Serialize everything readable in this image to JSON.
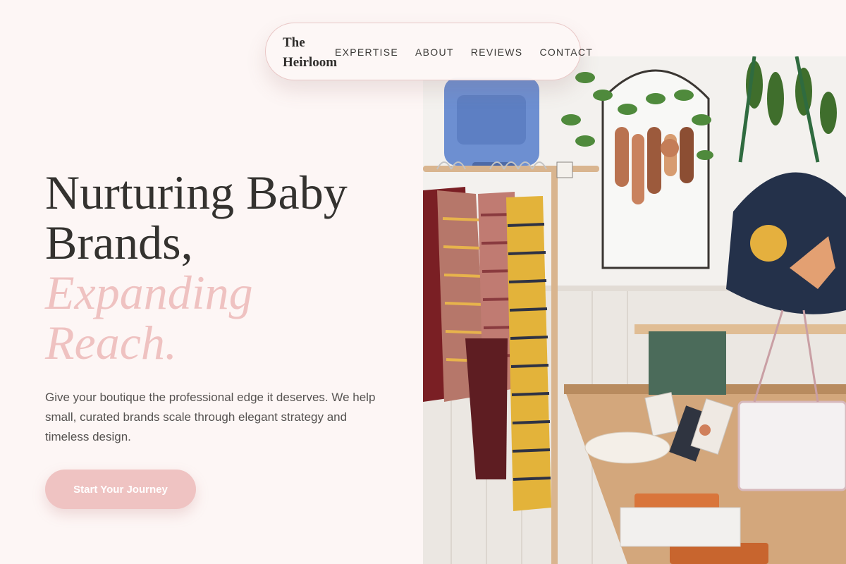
{
  "brand": {
    "name_line1": "The",
    "name_line2": "Heirloom"
  },
  "nav": {
    "items": [
      {
        "label": "EXPERTISE"
      },
      {
        "label": "ABOUT"
      },
      {
        "label": "REVIEWS"
      },
      {
        "label": "CONTACT"
      }
    ]
  },
  "hero": {
    "title_line1": "Nurturing Baby",
    "title_line2": "Brands,",
    "accent_line1": "Expanding",
    "accent_line2": "Reach.",
    "subtitle": "Give your boutique the professional edge it deserves. We help small, curated brands scale through elegant strategy and timeless design.",
    "cta_label": "Start Your Journey"
  },
  "image": {
    "subject": "boutique-interior-photo"
  },
  "colors": {
    "background": "#fdf6f5",
    "accent_pink": "#efc2c1",
    "text_dark": "#34322f",
    "text_body": "#555250"
  }
}
